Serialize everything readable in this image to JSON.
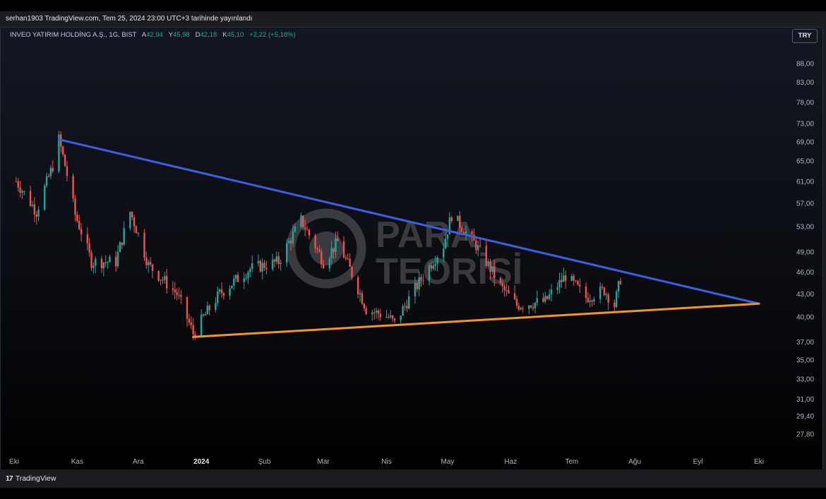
{
  "header": {
    "text": "serhan1903 TradingView.com, Tem 25, 2024 23:00 UTC+3 tarihinde yayınlandı"
  },
  "legend": {
    "symbol": "INVEO YATIRIM HOLDİNG A.Ş., 1G, BIST",
    "open_label": "A",
    "open_value": "42,94",
    "high_label": "Y",
    "high_value": "45,98",
    "low_label": "D",
    "low_value": "42,18",
    "close_label": "K",
    "close_value": "45,10",
    "change": "+2,22 (+5,18%)"
  },
  "currency_button": "TRY",
  "footer": {
    "brand": "TradingView",
    "brand_mark": "17"
  },
  "watermark": {
    "line1": "PARA",
    "line2": "TEORİSİ"
  },
  "colors": {
    "up": "#26a69a",
    "down": "#ef5350",
    "resistance_line": "#3d5fe0",
    "support_line": "#f0952a",
    "background": "#0b0d12",
    "axis_text": "#b2b5be"
  },
  "chart_data": {
    "type": "candlestick",
    "price_scale": "log",
    "currency": "TRY",
    "y_ticks": [
      "88,00",
      "83,00",
      "78,00",
      "73,00",
      "69,00",
      "65,00",
      "61,00",
      "57,00",
      "53,00",
      "49,00",
      "46,00",
      "43,00",
      "40,00",
      "37,00",
      "35,00",
      "33,00",
      "31,00",
      "29,40",
      "27,80"
    ],
    "y_tick_values": [
      88,
      83,
      78,
      73,
      69,
      65,
      61,
      57,
      53,
      49,
      46,
      43,
      40,
      37,
      35,
      33,
      31,
      29.4,
      27.8
    ],
    "x_ticks": [
      {
        "label": "Eki",
        "date": "2023-10-01"
      },
      {
        "label": "Kas",
        "date": "2023-11-01"
      },
      {
        "label": "Ara",
        "date": "2023-12-01"
      },
      {
        "label": "2024",
        "date": "2024-01-01",
        "bold": true
      },
      {
        "label": "Şub",
        "date": "2024-02-01"
      },
      {
        "label": "Mar",
        "date": "2024-03-01"
      },
      {
        "label": "Nis",
        "date": "2024-04-01"
      },
      {
        "label": "May",
        "date": "2024-05-01"
      },
      {
        "label": "Haz",
        "date": "2024-06-01"
      },
      {
        "label": "Tem",
        "date": "2024-07-01"
      },
      {
        "label": "Ağu",
        "date": "2024-08-01"
      },
      {
        "label": "Eyl",
        "date": "2024-09-01"
      },
      {
        "label": "Eki",
        "date": "2024-10-01"
      }
    ],
    "trendlines": [
      {
        "name": "resistance",
        "from": {
          "date": "2023-10-23",
          "price": 69.5
        },
        "to": {
          "date": "2024-10-01",
          "price": 41.7
        }
      },
      {
        "name": "support",
        "from": {
          "date": "2023-12-28",
          "price": 37.6
        },
        "to": {
          "date": "2024-10-01",
          "price": 41.7
        }
      }
    ],
    "key_points": [
      {
        "date": "2023-10-02",
        "price": 61.0
      },
      {
        "date": "2023-10-12",
        "price": 55.5
      },
      {
        "date": "2023-10-20",
        "price": 64.0
      },
      {
        "date": "2023-10-23",
        "price": 69.5
      },
      {
        "date": "2023-10-31",
        "price": 55.0
      },
      {
        "date": "2023-11-08",
        "price": 47.5
      },
      {
        "date": "2023-11-20",
        "price": 47.5
      },
      {
        "date": "2023-11-27",
        "price": 55.5
      },
      {
        "date": "2023-12-06",
        "price": 47.0
      },
      {
        "date": "2023-12-20",
        "price": 43.0
      },
      {
        "date": "2023-12-28",
        "price": 38.0
      },
      {
        "date": "2024-01-10",
        "price": 43.0
      },
      {
        "date": "2024-01-25",
        "price": 46.5
      },
      {
        "date": "2024-02-08",
        "price": 47.5
      },
      {
        "date": "2024-02-19",
        "price": 54.0
      },
      {
        "date": "2024-03-01",
        "price": 47.5
      },
      {
        "date": "2024-03-08",
        "price": 50.5
      },
      {
        "date": "2024-03-22",
        "price": 41.0
      },
      {
        "date": "2024-04-02",
        "price": 40.0
      },
      {
        "date": "2024-04-05",
        "price": 39.2
      },
      {
        "date": "2024-04-18",
        "price": 45.0
      },
      {
        "date": "2024-04-29",
        "price": 50.0
      },
      {
        "date": "2024-05-03",
        "price": 55.0
      },
      {
        "date": "2024-05-15",
        "price": 50.0
      },
      {
        "date": "2024-05-27",
        "price": 44.0
      },
      {
        "date": "2024-06-04",
        "price": 41.5
      },
      {
        "date": "2024-06-18",
        "price": 42.0
      },
      {
        "date": "2024-06-28",
        "price": 45.5
      },
      {
        "date": "2024-07-08",
        "price": 42.5
      },
      {
        "date": "2024-07-17",
        "price": 43.5
      },
      {
        "date": "2024-07-22",
        "price": 41.5
      },
      {
        "date": "2024-07-25",
        "price": 45.1
      }
    ]
  }
}
